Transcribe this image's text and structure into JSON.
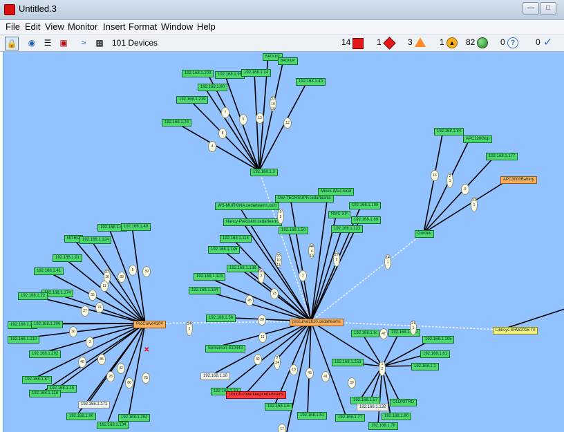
{
  "window": {
    "title": "Untitled.3",
    "min_icon": "minimize-icon",
    "max_icon": "maximize-icon"
  },
  "menu": [
    "File",
    "Edit",
    "View",
    "Monitor",
    "Insert",
    "Format",
    "Window",
    "Help"
  ],
  "toolbar": {
    "device_count": "101 Devices",
    "stats": [
      {
        "value": "14",
        "icon": "red-square-icon",
        "color": "#e01818"
      },
      {
        "value": "1",
        "icon": "red-diamond-icon",
        "color": "#e01818"
      },
      {
        "value": "3",
        "icon": "orange-triangle-icon",
        "color": "#ff8a2a"
      },
      {
        "value": "1",
        "icon": "yellow-warning-icon",
        "color": "#f8b020"
      },
      {
        "value": "82",
        "icon": "green-circle-icon",
        "color": "#30a030"
      },
      {
        "value": "0",
        "icon": "blue-question-icon",
        "color": "#2a6fd0"
      },
      {
        "value": "0",
        "icon": "checkmark-icon",
        "color": "#2a6fd0"
      }
    ]
  },
  "colors": {
    "canvas": "#92c2ff",
    "node_ok": "#4ed96e",
    "node_hub": "#ffae5c",
    "node_alert": "#ff3b3b"
  },
  "nodes": {
    "backup1": "BACKUP",
    "backup2": "BACKUP",
    "n1_60": "192.168.1.60",
    "n1_200": "192.168.1.200",
    "n1_96": "192.168.1.96",
    "n1_14": "192.168.1.14",
    "n1_40": "192.168.1.40",
    "n1_219": "192.168.1.219",
    "n1_26": "192.168.1.26",
    "n1_3": "192.168.1.3",
    "n1_84": "192.168.1.84",
    "apc2200": "APC2200top",
    "n1_177": "192.168.1.177",
    "apc3000": "APC3000Battery",
    "gurdev": "Gurdev",
    "mikes": "Mikes-iMac.local",
    "dwtech": "DW-TECHSUPP.cedarteams",
    "ws": "WS-MURKINA.cedarteams.com",
    "n1_109": "192.168.1.109",
    "rmc": "RMC-XP",
    "n1_89": "192.168.1.89",
    "nancy": "Nancy-Precision.cedarteams",
    "n1_122": "192.168.1.122",
    "n1_50": "192.168.1.50",
    "n1_114": "192.168.1.114",
    "n1_145": "192.168.1.145",
    "n1_138": "192.168.1.138",
    "n1_123": "192.168.1.123",
    "n1_164": "192.168.1.164",
    "n1_56": "192.168.1.56",
    "procurve_main": "procurve2610.cedarteams",
    "procurve_left": "ProCurve4104",
    "linksys": "Linksys SRW2016 Tn",
    "n1_43": "192.168.1.43",
    "n1_49": "192.168.1.49",
    "nitro": "NITRO",
    "n1_124": "192.168.1.124",
    "n1_91": "192.168.1.91",
    "n1_41": "192.168.1.41",
    "n1_174": "192.168.1.174",
    "n1_22x": "192.168.1.22",
    "n1_21": "192.168.1.21",
    "n1_206": "192.168.1.206",
    "n1_210": "192.168.1.210",
    "n1_202": "192.168.1.202",
    "n1_87": "192.168.1.87",
    "n1_15": "192.168.1.15",
    "n1_118": "192.168.1.118",
    "n1_171": "192.168.1.171",
    "n1_90": "192.168.1.90",
    "n1_204": "192.168.1.204",
    "n1_134": "192.168.1.134",
    "sentumon": "Sentumon-S10443",
    "n1_16": "192.168.1.16",
    "n1_30": "192.168.1.30",
    "alert1": "cloudft-cbeerkeepcedarteams",
    "n1_6": "192.168.1.6",
    "n1_51": "192.168.1.51",
    "n1_77": "192.168.1.77",
    "n1_57": "192.168.1.57",
    "n1_132": "192.168.1.132",
    "n1_78": "192.168.1.78",
    "n1_80": "192.168.1.80",
    "oldnitro": "OLDNITRO",
    "n1_1": "192.168.1.1",
    "n1_253": "192.168.1.253",
    "n1_tx": "192.168.1.tx",
    "n1_229": "192.168.1.229",
    "n1_105": "192.168.1.105",
    "n1_61": "192.168.1.61"
  },
  "badges": {
    "b1": "7",
    "b2": "5",
    "b3": "13",
    "b4": "12",
    "b5": "21\n10\n10",
    "b6": "8",
    "b7": "4",
    "b8": "16",
    "b9": "2\n1",
    "b10": "9",
    "b11": "21\n1",
    "b12": "9\n8",
    "b13": "44\n4\n10",
    "b14": "27\n2",
    "b15": "14\n1",
    "b16": "35\n10\n11",
    "b17": "26\n2",
    "b18": "45",
    "b19": "23",
    "b20": "29",
    "b21": "3",
    "b22": "39",
    "b23": "5",
    "b24": "89",
    "b25": "27\n10",
    "b26": "11",
    "b27": "35",
    "b28": "74",
    "b29": "27",
    "b30": "30",
    "b31": "3",
    "b32": "40",
    "b33": "85",
    "b34": "42",
    "b35": "28",
    "b36": "80",
    "b37": "25",
    "b38": "24\n1",
    "b39": "11",
    "b40": "32",
    "b41": "2\n24",
    "b42": "13",
    "b43": "43",
    "b44": "41",
    "b45": "47",
    "b46": "21\n1",
    "b47": "1\n2",
    "b48": "39",
    "b49": "17"
  }
}
